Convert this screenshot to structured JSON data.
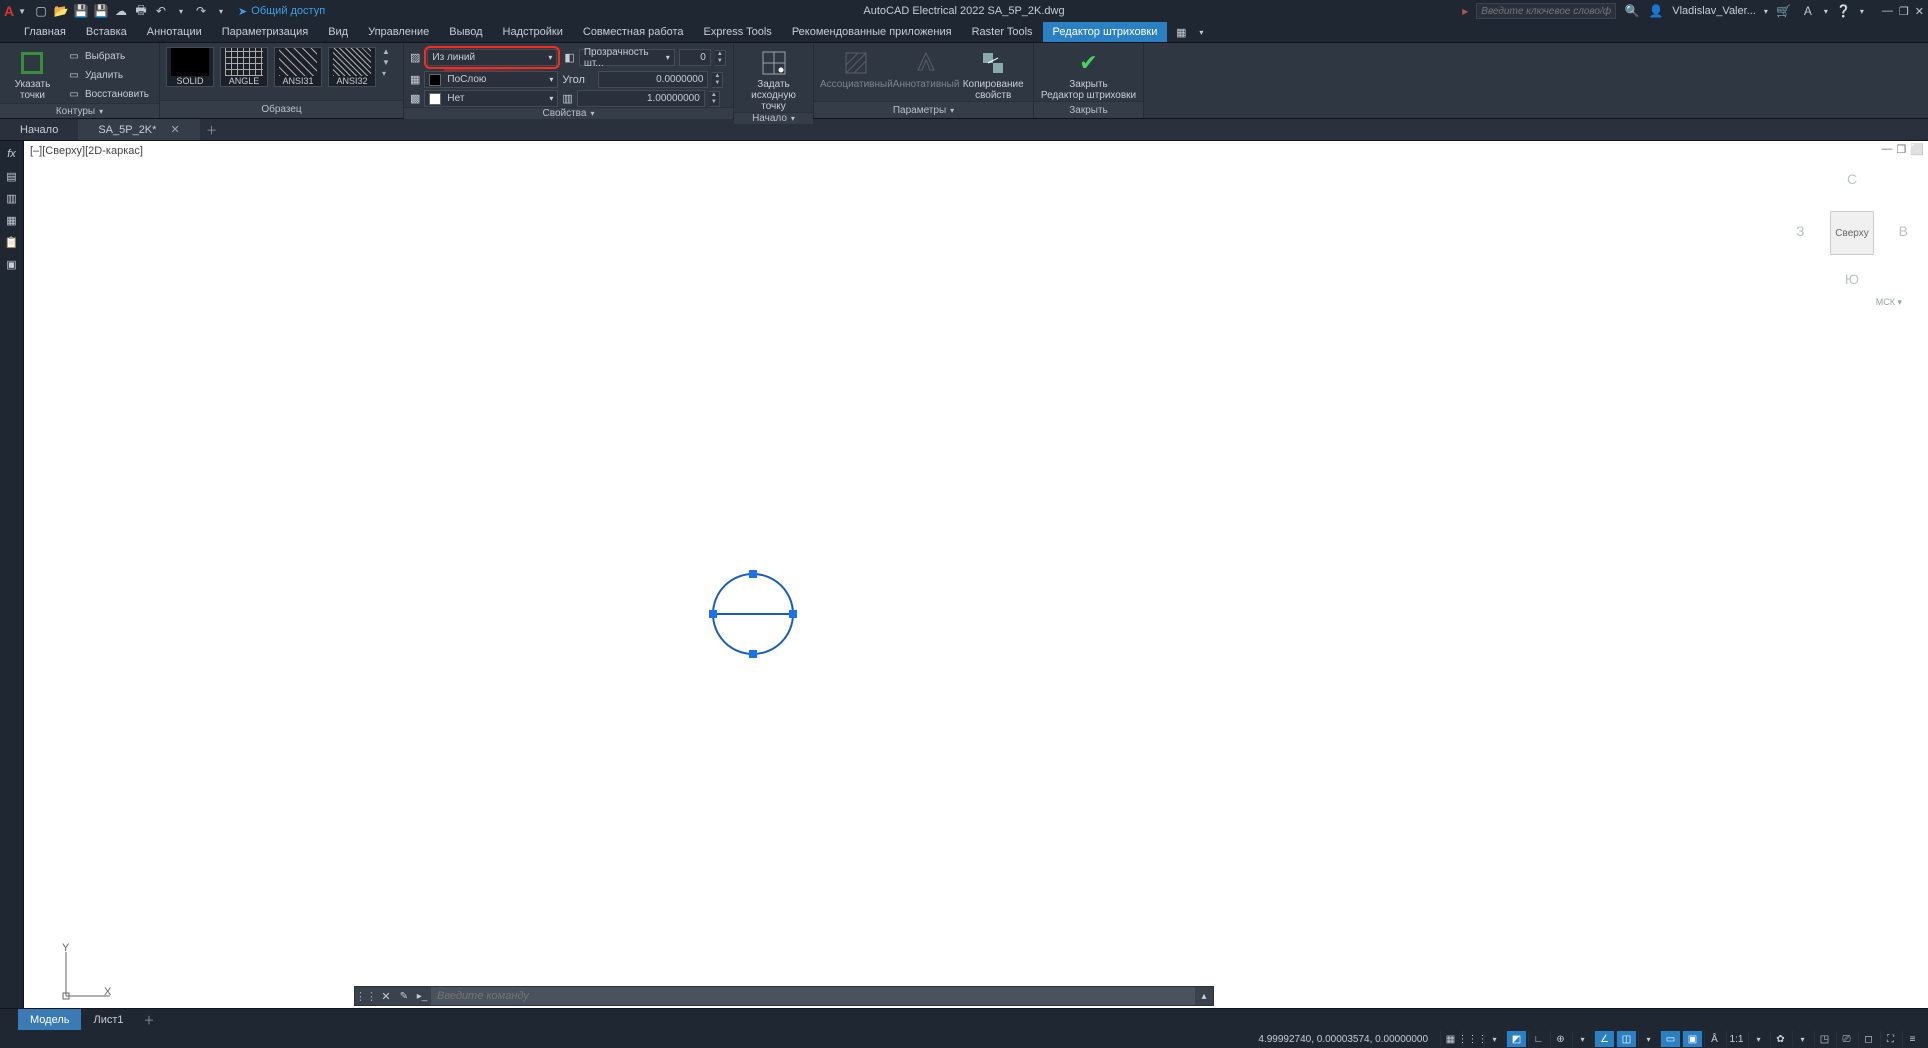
{
  "app_title": "AutoCAD Electrical 2022   SA_5P_2K.dwg",
  "share_label": "Общий доступ",
  "search_placeholder": "Введите ключевое слово/фразу",
  "user_name": "Vladislav_Valer...",
  "menu_tabs": [
    "Главная",
    "Вставка",
    "Аннотации",
    "Параметризация",
    "Вид",
    "Управление",
    "Вывод",
    "Надстройки",
    "Совместная работа",
    "Express Tools",
    "Рекомендованные приложения",
    "Raster Tools",
    "Редактор штриховки"
  ],
  "active_menu_index": 12,
  "ribbon": {
    "boundaries_panel": {
      "pick": "Указать точки",
      "select": "Выбрать",
      "remove": "Удалить",
      "recreate": "Восстановить",
      "title": "Контуры"
    },
    "pattern_panel": {
      "items": [
        {
          "name": "SOLID"
        },
        {
          "name": "ANGLE"
        },
        {
          "name": "ANSI31"
        },
        {
          "name": "ANSI32"
        }
      ],
      "title": "Образец"
    },
    "props_panel": {
      "hatch_type": "Из линий",
      "color_label": "ПоСлою",
      "bg_label": "Нет",
      "transp_label": "Прозрачность шт...",
      "transp_value": "0",
      "angle_label": "Угол",
      "angle_value": "0.0000000",
      "scale_value": "1.00000000",
      "title": "Свойства"
    },
    "origin_panel": {
      "set_origin_l1": "Задать",
      "set_origin_l2": "исходную точку",
      "title": "Начало"
    },
    "options_panel": {
      "assoc": "Ассоциативный",
      "annot": "Аннотативный",
      "copyprops_l1": "Копирование",
      "copyprops_l2": "свойств",
      "title": "Параметры"
    },
    "close_panel": {
      "close_l1": "Закрыть",
      "close_l2": "Редактор штриховки",
      "title": "Закрыть"
    }
  },
  "dwg_tabs": {
    "start": "Начало",
    "file": "SA_5P_2K*"
  },
  "canvas": {
    "bracket": "[–][Сверху][2D-каркас]",
    "viewcube": {
      "n": "С",
      "s": "Ю",
      "e": "В",
      "w": "З",
      "face": "Сверху",
      "wcs": "МСК ▾"
    }
  },
  "cmdline_placeholder": "Введите команду",
  "layout_tabs": {
    "model": "Модель",
    "sheet": "Лист1"
  },
  "status_coords": "4.99992740, 0.00003574, 0.00000000",
  "status_scale": "1:1"
}
